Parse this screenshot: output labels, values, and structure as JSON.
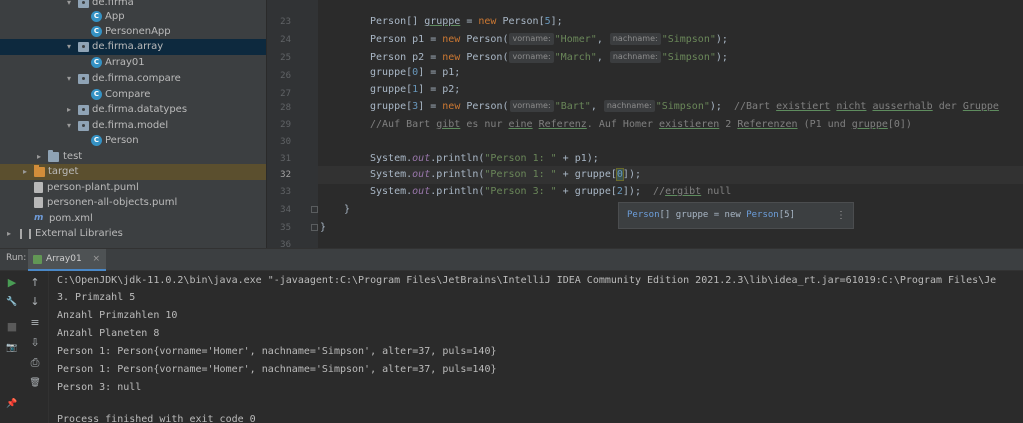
{
  "project_tree": {
    "items": [
      {
        "label": "de.firma",
        "icon": "package-icon",
        "arrow": "open"
      },
      {
        "label": "App",
        "icon": "class-icon"
      },
      {
        "label": "PersonenApp",
        "icon": "class-icon"
      },
      {
        "label": "de.firma.array",
        "icon": "package-icon",
        "arrow": "open"
      },
      {
        "label": "Array01",
        "icon": "class-icon"
      },
      {
        "label": "de.firma.compare",
        "icon": "package-icon",
        "arrow": "open"
      },
      {
        "label": "Compare",
        "icon": "class-icon"
      },
      {
        "label": "de.firma.datatypes",
        "icon": "package-icon",
        "arrow": "closed"
      },
      {
        "label": "de.firma.model",
        "icon": "package-icon",
        "arrow": "open"
      },
      {
        "label": "Person",
        "icon": "class-icon"
      },
      {
        "label": "test",
        "icon": "folder-icon",
        "arrow": "closed"
      },
      {
        "label": "target",
        "icon": "folder-icon",
        "arrow": "closed"
      },
      {
        "label": "person-plant.puml",
        "icon": "file-icon"
      },
      {
        "label": "personen-all-objects.puml",
        "icon": "file-icon"
      },
      {
        "label": "pom.xml",
        "icon": "maven-icon"
      },
      {
        "label": "External Libraries",
        "icon": "libraries-icon",
        "arrow": "closed"
      }
    ]
  },
  "editor": {
    "line_numbers": [
      "23",
      "24",
      "25",
      "26",
      "27",
      "28",
      "29",
      "30",
      "31",
      "32",
      "33",
      "34",
      "35",
      "36"
    ],
    "active_line": "32",
    "code": {
      "l23_a": "Person[] ",
      "l23_b": "gruppe",
      "l23_c": " = ",
      "l23_d": "new",
      "l23_e": " Person[",
      "l23_f": "5",
      "l23_g": "];",
      "l24_a": "Person p1 = ",
      "l24_b": "new",
      "l24_c": " Person(",
      "l24_h1": "vorname:",
      "l24_s1": "\"Homer\"",
      "l24_d": ", ",
      "l24_h2": "nachname:",
      "l24_s2": "\"Simpson\"",
      "l24_e": ");",
      "l25_a": "Person p2 = ",
      "l25_b": "new",
      "l25_c": " Person(",
      "l25_h1": "vorname:",
      "l25_s1": "\"March\"",
      "l25_d": ", ",
      "l25_h2": "nachname:",
      "l25_s2": "\"Simpson\"",
      "l25_e": ");",
      "l26_a": "gruppe[",
      "l26_b": "0",
      "l26_c": "] = p1;",
      "l27_a": "gruppe[",
      "l27_b": "1",
      "l27_c": "] = p2;",
      "l28_a": "gruppe[",
      "l28_b": "3",
      "l28_c": "] = ",
      "l28_d": "new",
      "l28_e": " Person(",
      "l28_h1": "vorname:",
      "l28_s1": "\"Bart\"",
      "l28_f": ", ",
      "l28_h2": "nachname:",
      "l28_s2": "\"Simpson\"",
      "l28_g": ");  ",
      "l28_c1": "//Bart ",
      "l28_c2": "existiert",
      "l28_c3": " ",
      "l28_c4": "nicht",
      "l28_c5": " ",
      "l28_c6": "ausserhalb",
      "l28_c7": " der ",
      "l28_c8": "Gruppe",
      "l29_c1": "//Auf Bart ",
      "l29_c2": "gibt",
      "l29_c3": " es nur ",
      "l29_c4": "eine",
      "l29_c5": " ",
      "l29_c6": "Referenz",
      "l29_c7": ". Auf Homer ",
      "l29_c8": "existieren",
      "l29_c9": " 2 ",
      "l29_c10": "Referenzen",
      "l29_c11": " (P1 und ",
      "l29_c12": "gruppe",
      "l29_c13": "[0])",
      "l31_a": "System.",
      "l31_b": "out",
      "l31_c": ".println(",
      "l31_s": "\"Person 1: \"",
      "l31_d": " + p1);",
      "l32_a": "System.",
      "l32_b": "out",
      "l32_c": ".println(",
      "l32_s": "\"Person 1: \"",
      "l32_d": " + gruppe",
      "l32_e": "[",
      "l32_f": "0",
      "l32_g": "]",
      "l32_h": ");",
      "l33_a": "System.",
      "l33_b": "out",
      "l33_c": ".println(",
      "l33_s": "\"Person 3: \"",
      "l33_d": " + gruppe[",
      "l33_e": "2",
      "l33_f": "]);  ",
      "l33_c1": "//",
      "l33_c2": "ergibt",
      "l33_c3": " null",
      "l34": "}",
      "l35": "}"
    },
    "popup": {
      "t1": "Person",
      "t2": "[] gruppe = new ",
      "t3": "Person",
      "t4": "[5]",
      "menu": "⋮"
    }
  },
  "run_panel": {
    "label": "Run:",
    "tab_label": "Array01",
    "tab_close": "×",
    "toolbar": {
      "run": "▶",
      "wrench": "🔧",
      "stop": "■",
      "camera": "📷",
      "pin": "📌",
      "up": "↑",
      "down": "↓",
      "wrap": "≡",
      "scroll": "⇩",
      "print": "⎙",
      "trash": "🗑"
    },
    "output": [
      "C:\\OpenJDK\\jdk-11.0.2\\bin\\java.exe \"-javaagent:C:\\Program Files\\JetBrains\\IntelliJ IDEA Community Edition 2021.2.3\\lib\\idea_rt.jar=61019:C:\\Program Files\\Je",
      "3. Primzahl 5",
      "Anzahl Primzahlen 10",
      "Anzahl Planeten 8",
      "Person 1: Person{vorname='Homer', nachname='Simpson', alter=37, puls=140}",
      "Person 1: Person{vorname='Homer', nachname='Simpson', alter=37, puls=140}",
      "Person 3: null",
      "",
      "Process finished with exit code 0"
    ]
  },
  "colors": {
    "keyword": "#cc7832",
    "string": "#6a8759",
    "number": "#6897bb",
    "comment": "#808080",
    "selection": "#0d293e"
  }
}
